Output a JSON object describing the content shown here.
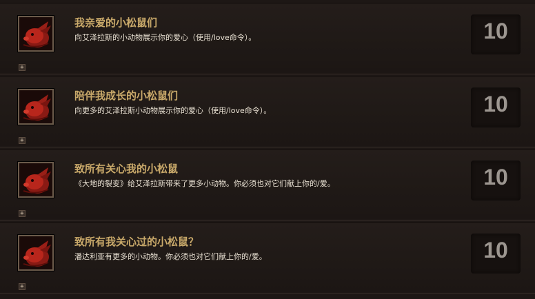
{
  "achievements": [
    {
      "title": "我亲爱的小松鼠们",
      "description": "向艾泽拉斯的小动物展示你的爱心（使用/love命令）。",
      "points": "10",
      "expand_symbol": "+"
    },
    {
      "title": "陪伴我成长的小松鼠们",
      "description": "向更多的艾泽拉斯小动物展示你的爱心（使用/love命令）。",
      "points": "10",
      "expand_symbol": "+"
    },
    {
      "title": "致所有关心我的小松鼠",
      "description": "《大地的裂变》给艾泽拉斯带来了更多小动物。你必须也对它们献上你的/爱。",
      "points": "10",
      "expand_symbol": "+"
    },
    {
      "title": "致所有我关心过的小松鼠？",
      "description": "潘达利亚有更多的小动物。你必须也对它们献上你的/爱。",
      "points": "10",
      "expand_symbol": "+"
    }
  ],
  "icon": "red-rabbit-icon",
  "colors": {
    "title": "#c9a96a",
    "description": "#e8e0d2",
    "points": "#9c9690",
    "background": "#1d1715"
  }
}
